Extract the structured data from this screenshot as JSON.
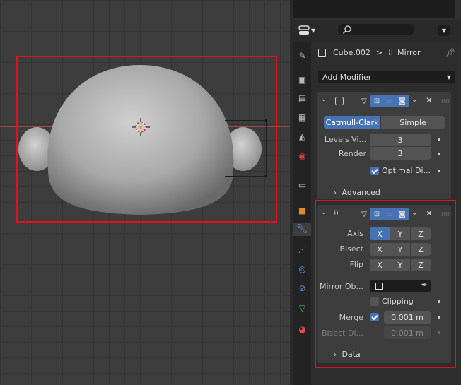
{
  "header": {
    "search_placeholder": "",
    "breadcrumb_object": "Cube.002",
    "breadcrumb_sep": ">",
    "breadcrumb_modifier": "Mirror",
    "add_modifier": "Add Modifier"
  },
  "subsurf": {
    "catmull": "Catmull-Clark",
    "simple": "Simple",
    "levels_label": "Levels Vi...",
    "levels_value": "3",
    "render_label": "Render",
    "render_value": "3",
    "optimal_label": "Optimal Di...",
    "advanced": "Advanced"
  },
  "mirror": {
    "axis_label": "Axis",
    "bisect_label": "Bisect",
    "flip_label": "Flip",
    "x": "X",
    "y": "Y",
    "z": "Z",
    "mirror_obj_label": "Mirror Ob...",
    "clipping": "Clipping",
    "merge_label": "Merge",
    "merge_value": "0.001 m",
    "bisect_dist_label": "Bisect Di...",
    "bisect_dist_value": "0.001 m",
    "data": "Data"
  },
  "colors": {
    "accent": "#4772b3",
    "highlight": "#e0141c"
  }
}
